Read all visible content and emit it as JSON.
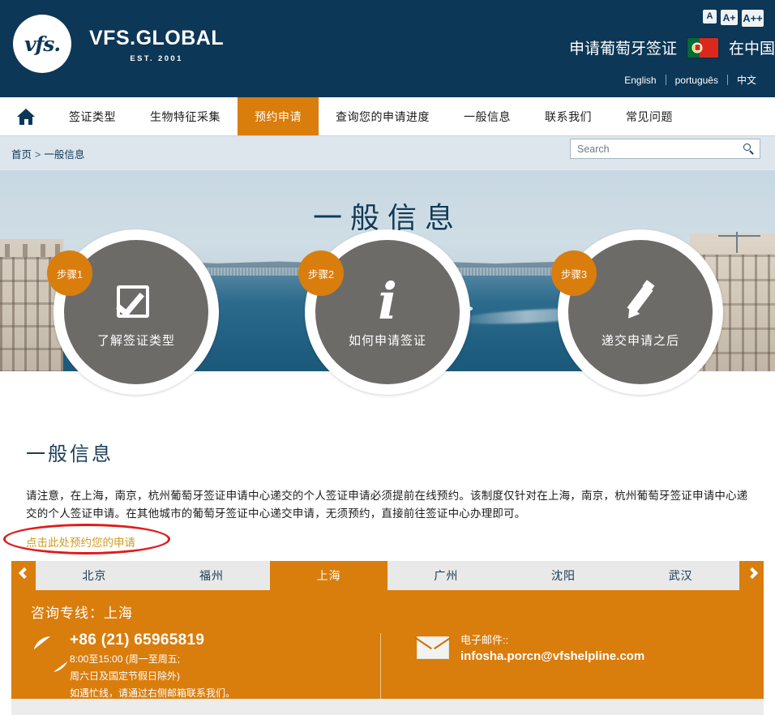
{
  "header": {
    "logo": {
      "mark": "vfs.",
      "title": "VFS.GLOBAL",
      "established": "EST. 2001"
    },
    "font_sizer": {
      "small": "A",
      "medium": "A+",
      "large": "A++"
    },
    "apply_prefix": "申请葡萄牙签证",
    "apply_suffix": "在中国",
    "flag_name": "portugal-flag",
    "languages": [
      {
        "label": "English"
      },
      {
        "label": "português"
      },
      {
        "label": "中文"
      }
    ]
  },
  "nav": {
    "home_icon": "home-icon",
    "items": [
      {
        "label": "签证类型",
        "active": false
      },
      {
        "label": "生物特征采集",
        "active": false
      },
      {
        "label": "预约申请",
        "active": true
      },
      {
        "label": "查询您的申请进度",
        "active": false
      },
      {
        "label": "一般信息",
        "active": false
      },
      {
        "label": "联系我们",
        "active": false
      },
      {
        "label": "常见问题",
        "active": false
      }
    ]
  },
  "breadcrumb": {
    "home": "首页",
    "separator": ">",
    "current": "一般信息"
  },
  "search": {
    "placeholder": "Search",
    "value": "",
    "icon": "search-icon"
  },
  "hero": {
    "title": "一般信息",
    "steps": [
      {
        "badge": "步骤1",
        "caption": "了解签证类型",
        "icon": "checkbox-check-icon"
      },
      {
        "badge": "步骤2",
        "caption": "如何申请签证",
        "icon": "information-icon"
      },
      {
        "badge": "步骤3",
        "caption": "递交申请之后",
        "icon": "pencil-icon"
      }
    ]
  },
  "main": {
    "section_title": "一般信息",
    "paragraph": "请注意，在上海，南京，杭州葡萄牙签证申请中心递交的个人签证申请必须提前在线预约。该制度仅针对在上海，南京，杭州葡萄牙签证申请中心递交的个人签证申请。在其他城市的葡萄牙签证中心递交申请，无须预约，直接前往签证中心办理即可。",
    "appointment_link": "点击此处预约您的申请",
    "highlight_color": "#e01b1b",
    "link_color": "#d39a20"
  },
  "city_tabs": {
    "prev_icon": "chevron-left-icon",
    "next_icon": "chevron-right-icon",
    "items": [
      {
        "label": "北京",
        "active": false
      },
      {
        "label": "福州",
        "active": false
      },
      {
        "label": "上海",
        "active": true
      },
      {
        "label": "广州",
        "active": false
      },
      {
        "label": "沈阳",
        "active": false
      },
      {
        "label": "武汉",
        "active": false
      }
    ]
  },
  "contact": {
    "title": "咨询专线：上海",
    "phone_icon": "phone-icon",
    "phone_number": "+86 (21) 65965819",
    "hours_line1": "8:00至15:00 (周一至周五;",
    "hours_line2": "周六日及国定节假日除外)",
    "hours_line3": "如遇忙线，请通过右侧邮箱联系我们。",
    "mail_icon": "envelope-icon",
    "email_label": "电子邮件::",
    "email_address": "infosha.porcn@vfshelpline.com",
    "accent_color": "#d97d0d"
  }
}
